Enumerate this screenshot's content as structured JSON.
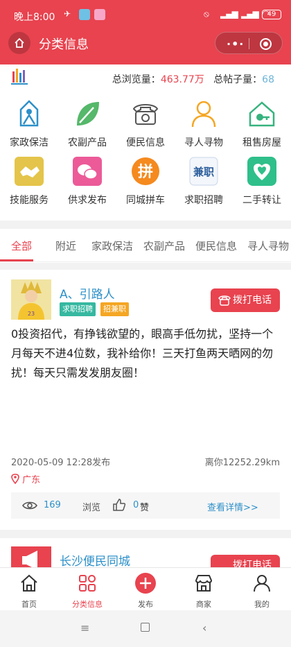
{
  "status_bar": {
    "time": "晚上8:00",
    "battery": "49"
  },
  "header": {
    "title": "分类信息"
  },
  "stats": {
    "views_label": "总浏览量：",
    "views_value": "463.77万",
    "posts_label": "总帖子量：",
    "posts_value": "68"
  },
  "categories": [
    {
      "label": "家政保洁",
      "icon": "house-cleaning-icon"
    },
    {
      "label": "农副产品",
      "icon": "leaf-icon"
    },
    {
      "label": "便民信息",
      "icon": "telephone-icon"
    },
    {
      "label": "寻人寻物",
      "icon": "person-icon"
    },
    {
      "label": "租售房屋",
      "icon": "house-key-icon"
    },
    {
      "label": "技能服务",
      "icon": "handshake-icon"
    },
    {
      "label": "供求发布",
      "icon": "chat-icon"
    },
    {
      "label": "同城拼车",
      "icon": "pin-char-icon"
    },
    {
      "label": "求职招聘",
      "icon": "job-icon"
    },
    {
      "label": "二手转让",
      "icon": "heart-pin-icon"
    }
  ],
  "tabs": [
    "全部",
    "附近",
    "家政保洁",
    "农副产品",
    "便民信息",
    "寻人寻物"
  ],
  "posts": [
    {
      "author": "A、引路人",
      "badges": [
        "求职招聘",
        "招兼职"
      ],
      "call_label": "拨打电话",
      "content": "0投资招代，有挣钱欲望的，眼高手低勿扰，坚持一个月每天不进4位数，我补给你！三天打鱼两天晒网的勿扰！每天只需发发朋友圈！",
      "date": "2020-05-09 12:28发布",
      "distance": "离你12252.29km",
      "location": "广东",
      "views": "169",
      "views_label": "浏览",
      "likes": "0",
      "likes_label": "赞",
      "detail_link": "查看详情>>"
    },
    {
      "author": "长沙便民同城",
      "call_label": "拨打电话"
    }
  ],
  "tabbar": [
    {
      "label": "首页",
      "icon": "home-icon"
    },
    {
      "label": "分类信息",
      "icon": "category-grid-icon"
    },
    {
      "label": "发布",
      "icon": "publish-plus-icon"
    },
    {
      "label": "商家",
      "icon": "shop-icon"
    },
    {
      "label": "我的",
      "icon": "user-icon"
    }
  ],
  "colors": {
    "brand": "#e8434f",
    "link": "#2d90c9"
  }
}
